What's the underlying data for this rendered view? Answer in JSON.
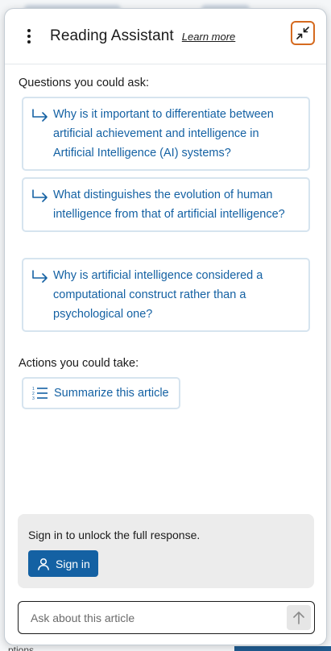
{
  "header": {
    "title": "Reading Assistant",
    "learn_more": "Learn more"
  },
  "questions": {
    "heading": "Questions you could ask:",
    "items": [
      {
        "text": "Why is it important to differentiate between artificial achievement and intelligence in Artificial Intelligence (AI) systems?"
      },
      {
        "text": "What distinguishes the evolution of human intelligence from that of artificial intelligence?"
      },
      {
        "text": "Why is artificial intelligence considered a computational construct rather than a psychological one?"
      }
    ]
  },
  "actions": {
    "heading": "Actions you could take:",
    "summarize_label": "Summarize this article"
  },
  "signin": {
    "message": "Sign in to unlock the full response.",
    "button_label": "Sign in"
  },
  "ask": {
    "placeholder": "Ask about this article"
  },
  "background": {
    "footer_fragment": "ptions"
  },
  "colors": {
    "accent": "#1461a3",
    "collapse_border": "#d56a1f",
    "card_border": "#d6e4ef",
    "signin_card_bg": "#ececec"
  },
  "icons": {
    "menu": "kebab-menu-icon",
    "collapse": "collapse-arrows-icon",
    "question": "return-arrow-icon",
    "summarize": "numbered-list-icon",
    "user": "user-icon",
    "send": "arrow-up-icon"
  }
}
